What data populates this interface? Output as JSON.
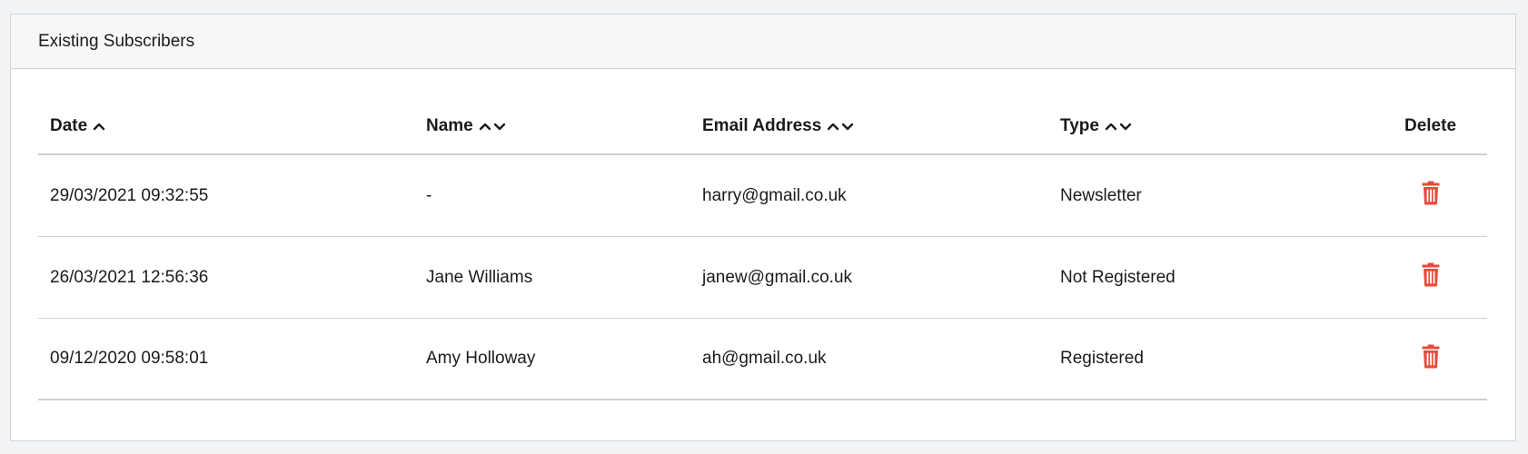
{
  "panel": {
    "title": "Existing Subscribers"
  },
  "table": {
    "headers": {
      "date": "Date",
      "name": "Name",
      "email": "Email Address",
      "type": "Type",
      "delete": "Delete"
    },
    "rows": [
      {
        "date": "29/03/2021 09:32:55",
        "name": "-",
        "email": "harry@gmail.co.uk",
        "type": "Newsletter"
      },
      {
        "date": "26/03/2021 12:56:36",
        "name": "Jane Williams",
        "email": "janew@gmail.co.uk",
        "type": "Not Registered"
      },
      {
        "date": "09/12/2020 09:58:01",
        "name": "Amy Holloway",
        "email": "ah@gmail.co.uk",
        "type": "Registered"
      }
    ]
  },
  "icons": {
    "sort_up": "chevron-up-icon",
    "sort_down": "chevron-down-icon",
    "delete": "trash-icon"
  },
  "colors": {
    "delete_icon": "#e74c3c",
    "border": "#c9d0d6",
    "header_bg": "#f7f7f7",
    "page_bg": "#f2f3f5"
  }
}
